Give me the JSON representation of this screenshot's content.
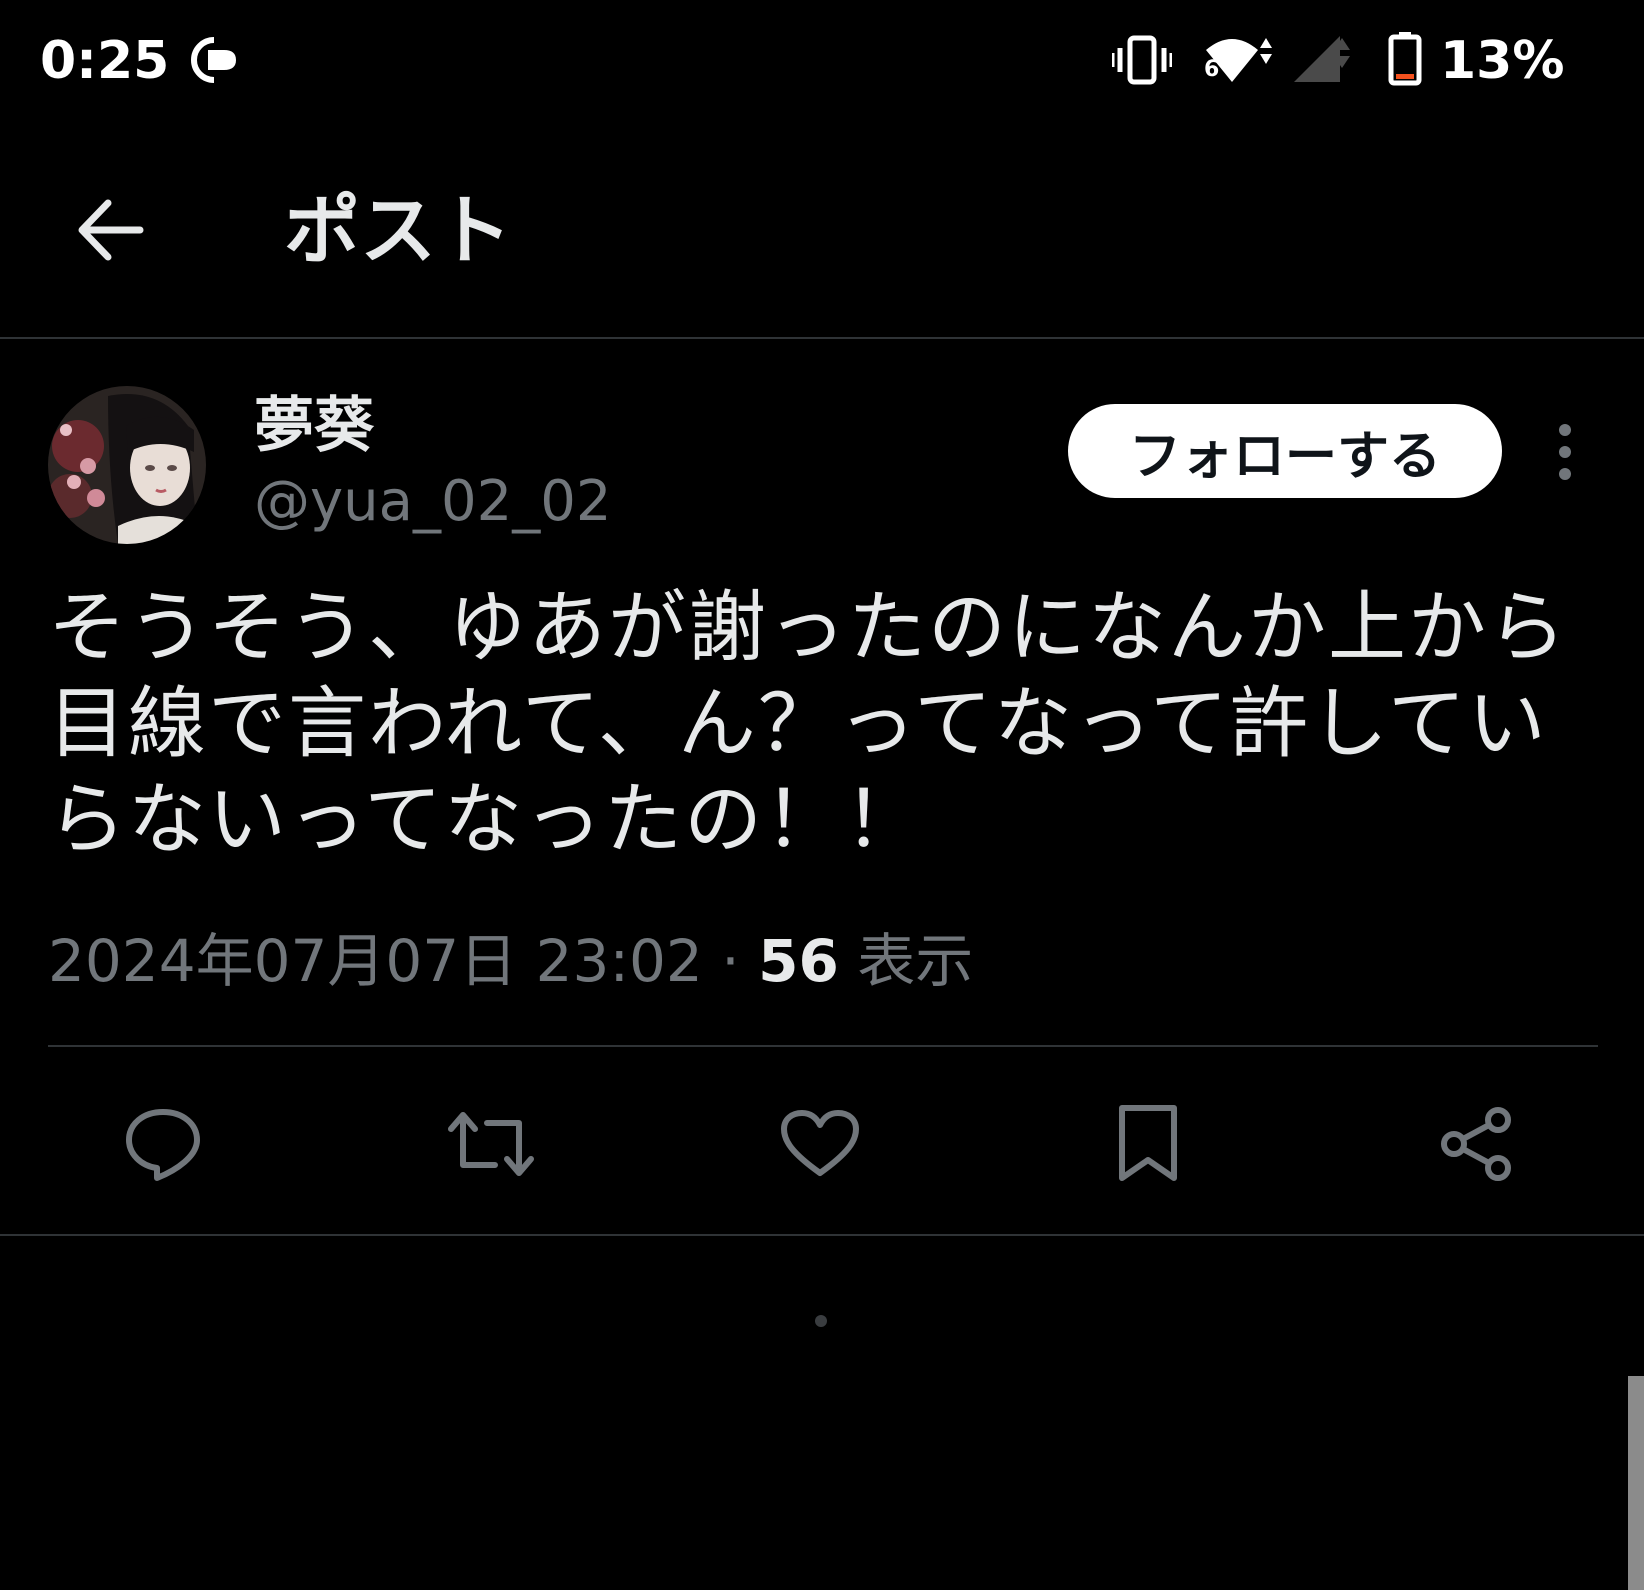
{
  "status_bar": {
    "time": "0:25",
    "network_badge": "6",
    "battery_percent": "13%",
    "icons": [
      "cast-icon",
      "vibrate-icon",
      "wifi-icon",
      "cellular-signal-icon",
      "battery-icon"
    ]
  },
  "header": {
    "back_icon": "arrow-left-icon",
    "title": "ポスト"
  },
  "post": {
    "author": {
      "display_name": "夢葵",
      "handle": "@yua_02_02"
    },
    "follow_label": "フォローする",
    "more_icon": "more-vertical-icon",
    "text": "そうそう、ゆあが謝ったのになんか上から目線で言われて、ん？ってなって許していらないってなったの！！",
    "timestamp": "2024年07月07日 23:02",
    "separator": "·",
    "views_count": "56",
    "views_label": "表示"
  },
  "actions": [
    {
      "name": "reply",
      "icon": "reply-icon"
    },
    {
      "name": "repost",
      "icon": "repost-icon"
    },
    {
      "name": "like",
      "icon": "heart-icon"
    },
    {
      "name": "bookmark",
      "icon": "bookmark-icon"
    },
    {
      "name": "share",
      "icon": "share-icon"
    }
  ],
  "colors": {
    "background": "#000000",
    "text_primary": "#e7e9ea",
    "text_secondary": "#71767b",
    "divider": "#2f3336",
    "battery_low": "#f4511e"
  }
}
